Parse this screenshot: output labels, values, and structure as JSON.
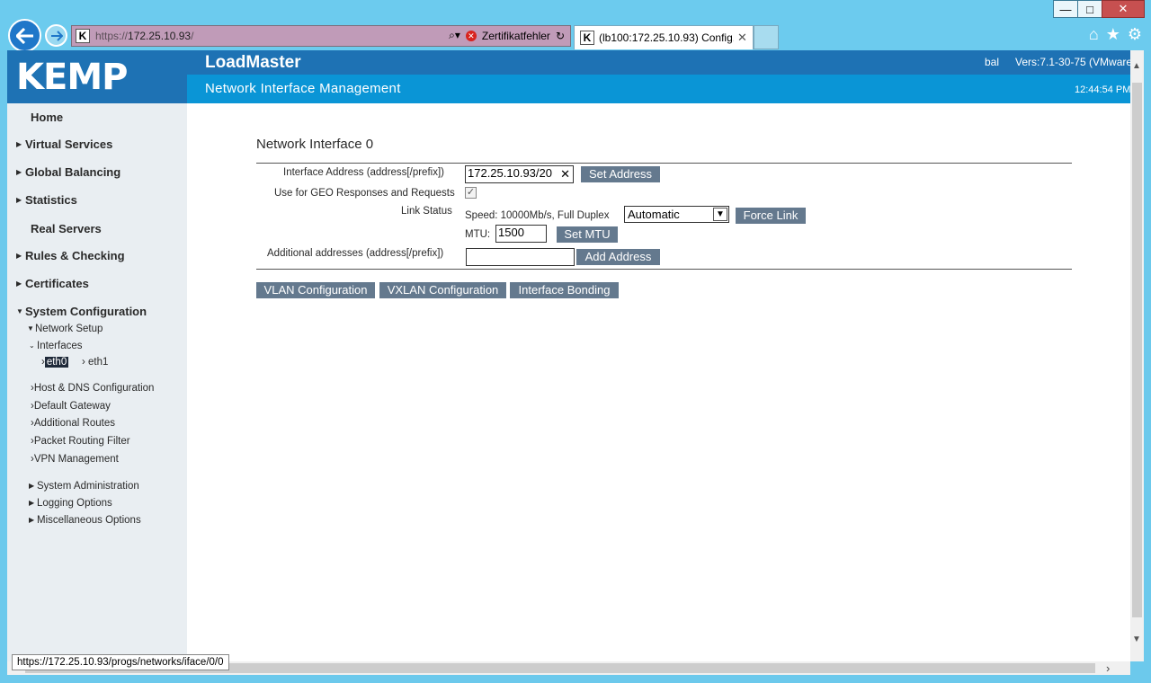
{
  "window": {
    "minimize": "—",
    "maximize": "□",
    "close": "✕"
  },
  "browser": {
    "url_proto": "https://",
    "url_host": "172.25.10.93",
    "url_rest": "/",
    "cert_error": "Zertifikatfehler",
    "tab_title": "(lb100:172.25.10.93) Config...",
    "favicon": "K",
    "status_url": "https://172.25.10.93/progs/networks/iface/0/0"
  },
  "header": {
    "logo": "KEMP",
    "app_title": "LoadMaster",
    "page_title": "Network Interface Management",
    "user": "bal",
    "version": "Vers:7.1-30-75 (VMware",
    "clock": "12:44:54 PM"
  },
  "sidebar": {
    "home": "Home",
    "virtual_services": "Virtual Services",
    "global_balancing": "Global Balancing",
    "statistics": "Statistics",
    "real_servers": "Real Servers",
    "rules_checking": "Rules & Checking",
    "certificates": "Certificates",
    "system_configuration": "System Configuration",
    "network_setup": "Network Setup",
    "interfaces": "Interfaces",
    "eth0": "eth0",
    "eth1": "eth1",
    "host_dns": "Host & DNS Configuration",
    "default_gateway": "Default Gateway",
    "additional_routes": "Additional Routes",
    "packet_routing_filter": "Packet Routing Filter",
    "vpn_management": "VPN Management",
    "system_administration": "System Administration",
    "logging_options": "Logging Options",
    "misc_options": "Miscellaneous Options"
  },
  "form": {
    "section_title": "Network Interface 0",
    "iface_addr_label": "Interface Address (address[/prefix])",
    "iface_addr_value": "172.25.10.93/20",
    "set_address": "Set Address",
    "geo_label": "Use for GEO Responses and Requests",
    "geo_checked": true,
    "link_status_label": "Link Status",
    "speed_text": "Speed: 10000Mb/s, Full Duplex",
    "link_mode": "Automatic",
    "force_link": "Force Link",
    "mtu_label": "MTU:",
    "mtu_value": "1500",
    "set_mtu": "Set MTU",
    "additional_label": "Additional addresses (address[/prefix])",
    "additional_value": "",
    "add_address": "Add Address",
    "vlan_config": "VLAN Configuration",
    "vxlan_config": "VXLAN Configuration",
    "iface_bonding": "Interface Bonding"
  }
}
